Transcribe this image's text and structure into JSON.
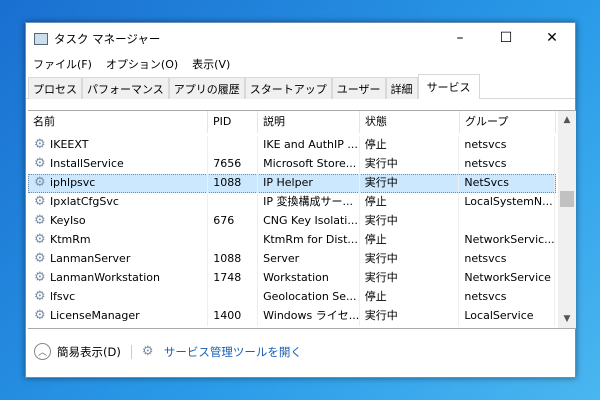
{
  "window": {
    "title": "タスク マネージャー",
    "minimize": "–",
    "maximize": "☐",
    "close": "✕"
  },
  "menu": [
    "ファイル(F)",
    "オプション(O)",
    "表示(V)"
  ],
  "tabs": [
    "プロセス",
    "パフォーマンス",
    "アプリの履歴",
    "スタートアップ",
    "ユーザー",
    "詳細",
    "サービス"
  ],
  "active_tab": "サービス",
  "columns": [
    "名前",
    "PID",
    "説明",
    "状態",
    "グループ"
  ],
  "rows": [
    [
      "IKEEXT",
      "",
      "IKE and AuthIP ...",
      "停止",
      "netsvcs"
    ],
    [
      "InstallService",
      "7656",
      "Microsoft Store...",
      "実行中",
      "netsvcs"
    ],
    [
      "iphlpsvc",
      "1088",
      "IP Helper",
      "実行中",
      "NetSvcs"
    ],
    [
      "IpxlatCfgSvc",
      "",
      "IP 変換構成サー...",
      "停止",
      "LocalSystemN..."
    ],
    [
      "KeyIso",
      "676",
      "CNG Key Isolati...",
      "実行中",
      ""
    ],
    [
      "KtmRm",
      "",
      "KtmRm for Dist...",
      "停止",
      "NetworkServic..."
    ],
    [
      "LanmanServer",
      "1088",
      "Server",
      "実行中",
      "netsvcs"
    ],
    [
      "LanmanWorkstation",
      "1748",
      "Workstation",
      "実行中",
      "NetworkService"
    ],
    [
      "lfsvc",
      "",
      "Geolocation Se...",
      "停止",
      "netsvcs"
    ],
    [
      "LicenseManager",
      "1400",
      "Windows ライセ...",
      "実行中",
      "LocalService"
    ]
  ],
  "selected_row": 2,
  "footer": {
    "fewer_details": "簡易表示(D)",
    "open_services": "サービス管理ツールを開く"
  }
}
